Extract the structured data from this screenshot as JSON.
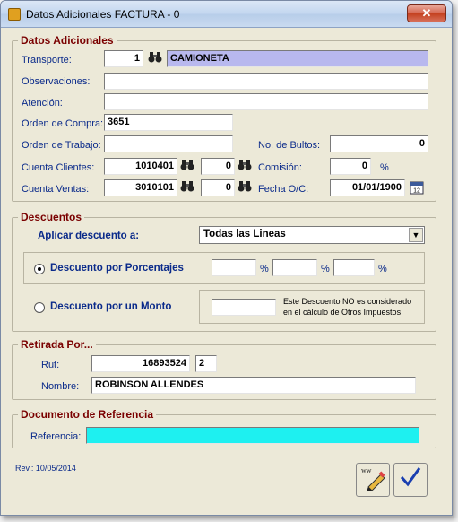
{
  "window": {
    "title": "Datos Adicionales FACTURA - 0",
    "close_glyph": "✕"
  },
  "adicionales": {
    "title": "Datos Adicionales",
    "transporte_label": "Transporte:",
    "transporte_code": "1",
    "transporte_name": "CAMIONETA",
    "observaciones_label": "Observaciones:",
    "observaciones_value": "",
    "atencion_label": "Atención:",
    "atencion_value": "",
    "orden_compra_label": "Orden de Compra:",
    "orden_compra_value": "3651",
    "orden_trabajo_label": "Orden de Trabajo:",
    "orden_trabajo_value": "",
    "bultos_label": "No. de Bultos:",
    "bultos_value": "0",
    "cuenta_clientes_label": "Cuenta Clientes:",
    "cuenta_clientes_value": "1010401",
    "cuenta_clientes_aux": "0",
    "comision_label": "Comisión:",
    "comision_value": "0",
    "comision_unit": "%",
    "cuenta_ventas_label": "Cuenta Ventas:",
    "cuenta_ventas_value": "3010101",
    "cuenta_ventas_aux": "0",
    "fecha_oc_label": "Fecha O/C:",
    "fecha_oc_value": "01/01/1900"
  },
  "descuentos": {
    "title": "Descuentos",
    "aplicar_label": "Aplicar descuento a:",
    "aplicar_value": "Todas las Lineas",
    "porcentajes_label": "Descuento por Porcentajes",
    "monto_label": "Descuento por un Monto",
    "pct_unit": "%",
    "pct_values": [
      "",
      "",
      ""
    ],
    "monto_value": "",
    "note_line1": "Este Descuento NO es considerado",
    "note_line2": "en el cálculo de Otros Impuestos"
  },
  "retirada": {
    "title": "Retirada Por...",
    "rut_label": "Rut:",
    "rut_value": "16893524",
    "rut_dv": "2",
    "nombre_label": "Nombre:",
    "nombre_value": "ROBINSON ALLENDES"
  },
  "referencia": {
    "title": "Documento de Referencia",
    "label": "Referencia:",
    "value": ""
  },
  "footer": {
    "rev": "Rev.: 10/05/2014"
  },
  "icons": {
    "binoculars": "binoculars-icon",
    "calendar": "calendar-icon",
    "edit": "edit-icon",
    "ok": "checkmark-icon"
  }
}
